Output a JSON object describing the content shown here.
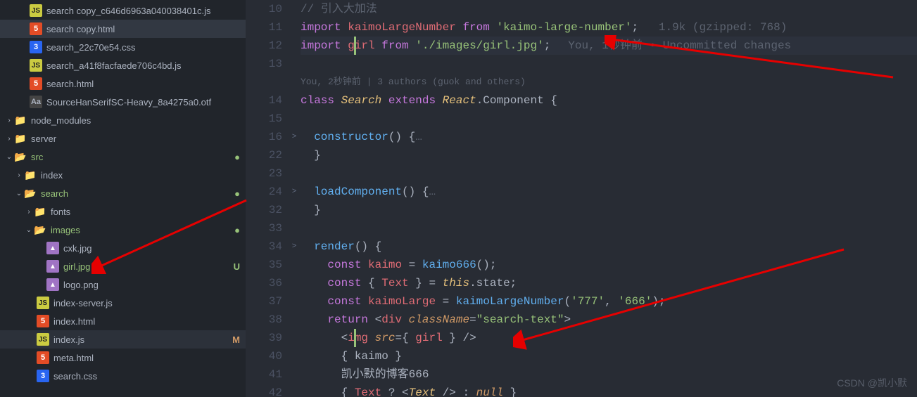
{
  "sidebar": {
    "items": [
      {
        "indent": 28,
        "icon": "js",
        "label": "search copy_c646d6963a040038401c.js"
      },
      {
        "indent": 28,
        "icon": "html",
        "label": "search copy.html",
        "selected": true
      },
      {
        "indent": 28,
        "icon": "css",
        "label": "search_22c70e54.css"
      },
      {
        "indent": 28,
        "icon": "js",
        "label": "search_a41f8facfaede706c4bd.js"
      },
      {
        "indent": 28,
        "icon": "html",
        "label": "search.html"
      },
      {
        "indent": 28,
        "icon": "font",
        "label": "SourceHanSerifSC-Heavy_8a4275a0.otf"
      },
      {
        "indent": 6,
        "chev": ">",
        "icon": "folder-m",
        "label": "node_modules"
      },
      {
        "indent": 6,
        "chev": ">",
        "icon": "folder",
        "label": "server"
      },
      {
        "indent": 6,
        "chev": "v",
        "icon": "folder-g",
        "label": "src",
        "green": true,
        "dot": true
      },
      {
        "indent": 20,
        "chev": ">",
        "icon": "folder",
        "label": "index"
      },
      {
        "indent": 20,
        "chev": "v",
        "icon": "folder-y",
        "label": "search",
        "green": true,
        "dot": true
      },
      {
        "indent": 34,
        "chev": ">",
        "icon": "folder-m",
        "label": "fonts"
      },
      {
        "indent": 34,
        "chev": "v",
        "icon": "folder-y",
        "label": "images",
        "green": true,
        "dot": true
      },
      {
        "indent": 52,
        "icon": "img",
        "label": "cxk.jpg"
      },
      {
        "indent": 52,
        "icon": "img",
        "label": "girl.jpg",
        "green": true,
        "status": "U"
      },
      {
        "indent": 52,
        "icon": "img",
        "label": "logo.png"
      },
      {
        "indent": 38,
        "icon": "js",
        "label": "index-server.js"
      },
      {
        "indent": 38,
        "icon": "html",
        "label": "index.html"
      },
      {
        "indent": 38,
        "icon": "js",
        "label": "index.js",
        "active": true,
        "status": "M",
        "statusCls": "m"
      },
      {
        "indent": 38,
        "icon": "html",
        "label": "meta.html"
      },
      {
        "indent": 38,
        "icon": "css",
        "label": "search.css"
      }
    ]
  },
  "gutter": [
    "10",
    "11",
    "12",
    "13",
    "",
    "14",
    "15",
    "16",
    "22",
    "23",
    "24",
    "32",
    "33",
    "34",
    "35",
    "36",
    "37",
    "38",
    "39",
    "40",
    "41",
    "42"
  ],
  "folds": {
    "7": ">",
    "10": ">",
    "13": ">"
  },
  "code": {
    "l10": "// 引入大加法",
    "l11_import": "import",
    "l11_name": "kaimoLargeNumber",
    "l11_from": "from",
    "l11_str": "'kaimo-large-number'",
    "l11_hint": "1.9k (gzipped: 768)",
    "l12_import": "import",
    "l12_name": "girl",
    "l12_from": "from",
    "l12_str": "'./images/girl.jpg'",
    "l12_blame": "You, 1秒钟前 • Uncommitted changes",
    "authors": "You, 2秒钟前 | 3 authors (guok and others)",
    "l14_class": "class",
    "l14_name": "Search",
    "l14_ext": "extends",
    "l14_react": "React",
    "l14_comp": ".Component {",
    "l16": "constructor",
    "l16_paren": "() {",
    "l16_dots": "…",
    "l22": "}",
    "l24": "loadComponent",
    "l24_paren": "() {",
    "l24_dots": "…",
    "l32": "}",
    "l34": "render",
    "l34_paren": "() {",
    "l35_const": "const",
    "l35_name": "kaimo",
    "l35_eq": " = ",
    "l35_fn": "kaimo666",
    "l35_end": "();",
    "l36_const": "const",
    "l36_brace": " { ",
    "l36_text": "Text",
    "l36_brace2": " } = ",
    "l36_this": "this",
    "l36_state": ".state;",
    "l37_const": "const",
    "l37_name": "kaimoLarge",
    "l37_eq": " = ",
    "l37_fn": "kaimoLargeNumber",
    "l37_args": "(",
    "l37_s1": "'777'",
    "l37_c": ", ",
    "l37_s2": "'666'",
    "l37_end": ");",
    "l38_ret": "return",
    "l38_open": " <",
    "l38_div": "div",
    "l38_attr": "className",
    "l38_eq": "=",
    "l38_str": "\"search-text\"",
    "l38_close": ">",
    "l39_open": "<",
    "l39_img": "img",
    "l39_attr": "src",
    "l39_eq": "=",
    "l39_b1": "{ ",
    "l39_val": "girl",
    "l39_b2": " }",
    "l39_close": " />",
    "l40": "{ kaimo }",
    "l41": "凯小默的博客666",
    "l42_b1": "{ ",
    "l42_text": "Text",
    "l42_q": " ? ",
    "l42_o": "<",
    "l42_tag": "Text",
    "l42_c": " />",
    "l42_colon": " : ",
    "l42_null": "null",
    "l42_b2": " }"
  },
  "watermark": "CSDN @凯小默"
}
